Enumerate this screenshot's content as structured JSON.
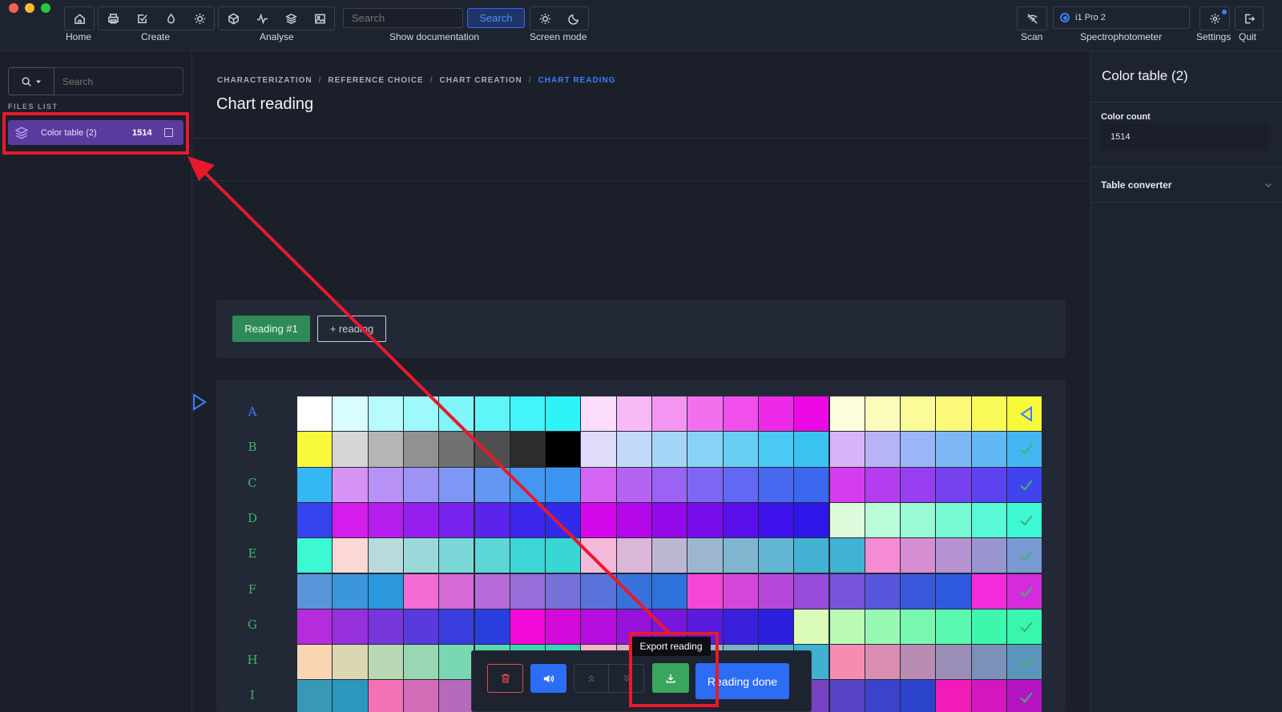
{
  "toolbar": {
    "home_label": "Home",
    "create_label": "Create",
    "analyse_label": "Analyse",
    "search_placeholder": "Search",
    "search_button": "Search",
    "documentation_label": "Show documentation",
    "screen_mode_label": "Screen mode",
    "scan_label": "Scan",
    "spectro_label": "Spectrophotometer",
    "spectro_device": "i1 Pro 2",
    "settings_label": "Settings",
    "quit_label": "Quit",
    "icons": {
      "home": "home-icon",
      "create": [
        "print-icon",
        "check-square-icon",
        "drop-icon",
        "sun-icon"
      ],
      "analyse": [
        "cube-icon",
        "pulse-icon",
        "layers-icon",
        "image-icon"
      ],
      "screen_mode": [
        "sun-icon",
        "moon-icon"
      ],
      "scan": "scan-off-icon",
      "settings": "gear-icon",
      "quit": "logout-icon"
    }
  },
  "sidebar": {
    "search_placeholder": "Search",
    "heading": "FILES LIST",
    "files": [
      {
        "name": "Color table (2)",
        "count": "1514",
        "selected": true
      }
    ]
  },
  "main": {
    "breadcrumb": [
      "CHARACTERIZATION",
      "REFERENCE CHOICE",
      "CHART CREATION",
      "CHART READING"
    ],
    "title": "Chart reading",
    "reading_tab": "Reading #1",
    "add_reading": "+ reading",
    "rows": [
      "A",
      "B",
      "C",
      "D",
      "E",
      "F",
      "G",
      "H",
      "I"
    ],
    "active_row": "A",
    "swatches": [
      [
        "#ffffff",
        "#d9fcfd",
        "#b8fbfc",
        "#9df9fa",
        "#80f8fa",
        "#5ef6f9",
        "#43f5f8",
        "#2ff4f7",
        "#fcdcfb",
        "#f7b9f5",
        "#f496f1",
        "#f270ee",
        "#f04feb",
        "#ee2ae8",
        "#ec08e5",
        "#fdfddc",
        "#fcfcba",
        "#fbfb98",
        "#fafa78",
        "#f9f958",
        "#f9f93c"
      ],
      [
        "#f9f93c",
        "#d6d6d6",
        "#b5b5b5",
        "#919191",
        "#717171",
        "#4f4f4f",
        "#2c2c2c",
        "#000000",
        "#dedcfa",
        "#c1daf9",
        "#a3d6f7",
        "#86d3f5",
        "#68cff3",
        "#4ac9f2",
        "#3bc3f0",
        "#d6b4f7",
        "#b7b3f7",
        "#9bb6f7",
        "#7db8f5",
        "#61b8f3",
        "#45b6f1"
      ],
      [
        "#34b7f2",
        "#d792f5",
        "#b891f5",
        "#9c94f5",
        "#7e97f5",
        "#6297f3",
        "#4596f1",
        "#3b94f0",
        "#d464f2",
        "#b563f3",
        "#9b63f3",
        "#7e66f3",
        "#6268f2",
        "#4669f0",
        "#3c67ef",
        "#d43cef",
        "#b43def",
        "#963ef0",
        "#7841f0",
        "#5c43ef",
        "#4043ee"
      ],
      [
        "#3443ed",
        "#d41ced",
        "#b41ded",
        "#951fee",
        "#7722ee",
        "#5b24ed",
        "#3f26ec",
        "#3329eb",
        "#d408ea",
        "#b408eb",
        "#950aeb",
        "#770ceb",
        "#5a0fea",
        "#3e12ea",
        "#2f16e9",
        "#dcfcdc",
        "#bafcd8",
        "#98fbd6",
        "#78fad5",
        "#58f9d4",
        "#3cf9d4"
      ],
      [
        "#3cf9d4",
        "#fbd7d5",
        "#b8dadb",
        "#9bd8d9",
        "#7bd7d7",
        "#5cd6d6",
        "#3fd5d5",
        "#38d6d5",
        "#f5bada",
        "#dab7d7",
        "#bcb6d3",
        "#9db6d0",
        "#7fb5cf",
        "#62b5d3",
        "#43b2d3",
        "#40b3d4",
        "#f58bd2",
        "#d68ed2",
        "#b792d1",
        "#9895d1",
        "#7999d2"
      ],
      [
        "#5996d9",
        "#3b96db",
        "#2c98dd",
        "#f46bd4",
        "#d56ad6",
        "#b66ad8",
        "#976dd7",
        "#7870d9",
        "#5773d9",
        "#3971db",
        "#2d72dc",
        "#f447d6",
        "#d447d8",
        "#b547da",
        "#964bdb",
        "#7753da",
        "#5856db",
        "#3a58dc",
        "#2e58dd",
        "#f32bda",
        "#d42cda"
      ],
      [
        "#b52cdc",
        "#962fdc",
        "#7735dc",
        "#583add",
        "#393ddd",
        "#2a3fde",
        "#f20ad8",
        "#d30ad9",
        "#b50ddb",
        "#9612db",
        "#7817dc",
        "#591cdc",
        "#3a1fdd",
        "#2b20de",
        "#dafcb8",
        "#b9fbb4",
        "#98fab2",
        "#79f9b0",
        "#5af8ae",
        "#3df7ad",
        "#38f6ae"
      ],
      [
        "#fad6b3",
        "#dad7b2",
        "#b9d7b2",
        "#98d7b2",
        "#79d7b2",
        "#5bd7b2",
        "#3ed6b4",
        "#35d6b6",
        "#f8b2c4",
        "#dab0c3",
        "#bab1c4",
        "#9ab2c6",
        "#7bb2c8",
        "#5eb2cb",
        "#40b1ce",
        "#f68db1",
        "#d88db1",
        "#b98db3",
        "#9a8eb6",
        "#7b91b8",
        "#5b95bc"
      ],
      [
        "#3a97b6",
        "#2a98bd",
        "#f372b5",
        "#d46db8",
        "#b56abb",
        "#9669bf",
        "#7766c2",
        "#5a66c5",
        "#3b67c8",
        "#2e67ca",
        "#f250b6",
        "#d34bb9",
        "#b446bc",
        "#9544c0",
        "#7643c3",
        "#5843c6",
        "#3a43c9",
        "#2c44cb",
        "#f21bba",
        "#d316be",
        "#b414c2"
      ]
    ],
    "row_status": [
      "pending",
      "done",
      "done",
      "done",
      "done",
      "done",
      "done",
      "done",
      "done"
    ]
  },
  "right_panel": {
    "title": "Color table (2)",
    "color_count_label": "Color count",
    "color_count_value": "1514",
    "accordion_label": "Table converter"
  },
  "bottom_bar": {
    "tooltip": "Export reading",
    "done_label": "Reading done",
    "icons": [
      "trash-icon",
      "speaker-icon",
      "chevrons-up-icon",
      "chevrons-down-icon",
      "download-icon"
    ]
  },
  "colors": {
    "accent_blue": "#2d6cf5",
    "success_green": "#3aa55d",
    "selection_purple": "#5b3a9e",
    "annotation_red": "#e8192c"
  }
}
